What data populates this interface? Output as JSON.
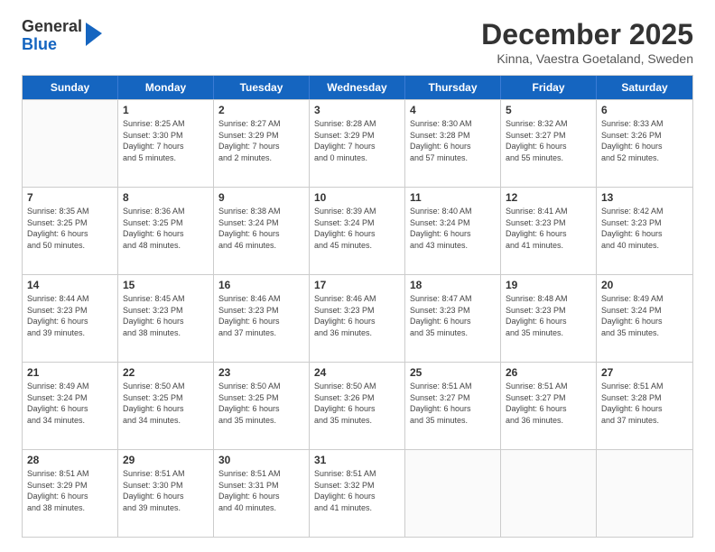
{
  "logo": {
    "general": "General",
    "blue": "Blue"
  },
  "title": "December 2025",
  "subtitle": "Kinna, Vaestra Goetaland, Sweden",
  "header_days": [
    "Sunday",
    "Monday",
    "Tuesday",
    "Wednesday",
    "Thursday",
    "Friday",
    "Saturday"
  ],
  "weeks": [
    [
      {
        "day": "",
        "info": ""
      },
      {
        "day": "1",
        "info": "Sunrise: 8:25 AM\nSunset: 3:30 PM\nDaylight: 7 hours\nand 5 minutes."
      },
      {
        "day": "2",
        "info": "Sunrise: 8:27 AM\nSunset: 3:29 PM\nDaylight: 7 hours\nand 2 minutes."
      },
      {
        "day": "3",
        "info": "Sunrise: 8:28 AM\nSunset: 3:29 PM\nDaylight: 7 hours\nand 0 minutes."
      },
      {
        "day": "4",
        "info": "Sunrise: 8:30 AM\nSunset: 3:28 PM\nDaylight: 6 hours\nand 57 minutes."
      },
      {
        "day": "5",
        "info": "Sunrise: 8:32 AM\nSunset: 3:27 PM\nDaylight: 6 hours\nand 55 minutes."
      },
      {
        "day": "6",
        "info": "Sunrise: 8:33 AM\nSunset: 3:26 PM\nDaylight: 6 hours\nand 52 minutes."
      }
    ],
    [
      {
        "day": "7",
        "info": "Sunrise: 8:35 AM\nSunset: 3:25 PM\nDaylight: 6 hours\nand 50 minutes."
      },
      {
        "day": "8",
        "info": "Sunrise: 8:36 AM\nSunset: 3:25 PM\nDaylight: 6 hours\nand 48 minutes."
      },
      {
        "day": "9",
        "info": "Sunrise: 8:38 AM\nSunset: 3:24 PM\nDaylight: 6 hours\nand 46 minutes."
      },
      {
        "day": "10",
        "info": "Sunrise: 8:39 AM\nSunset: 3:24 PM\nDaylight: 6 hours\nand 45 minutes."
      },
      {
        "day": "11",
        "info": "Sunrise: 8:40 AM\nSunset: 3:24 PM\nDaylight: 6 hours\nand 43 minutes."
      },
      {
        "day": "12",
        "info": "Sunrise: 8:41 AM\nSunset: 3:23 PM\nDaylight: 6 hours\nand 41 minutes."
      },
      {
        "day": "13",
        "info": "Sunrise: 8:42 AM\nSunset: 3:23 PM\nDaylight: 6 hours\nand 40 minutes."
      }
    ],
    [
      {
        "day": "14",
        "info": "Sunrise: 8:44 AM\nSunset: 3:23 PM\nDaylight: 6 hours\nand 39 minutes."
      },
      {
        "day": "15",
        "info": "Sunrise: 8:45 AM\nSunset: 3:23 PM\nDaylight: 6 hours\nand 38 minutes."
      },
      {
        "day": "16",
        "info": "Sunrise: 8:46 AM\nSunset: 3:23 PM\nDaylight: 6 hours\nand 37 minutes."
      },
      {
        "day": "17",
        "info": "Sunrise: 8:46 AM\nSunset: 3:23 PM\nDaylight: 6 hours\nand 36 minutes."
      },
      {
        "day": "18",
        "info": "Sunrise: 8:47 AM\nSunset: 3:23 PM\nDaylight: 6 hours\nand 35 minutes."
      },
      {
        "day": "19",
        "info": "Sunrise: 8:48 AM\nSunset: 3:23 PM\nDaylight: 6 hours\nand 35 minutes."
      },
      {
        "day": "20",
        "info": "Sunrise: 8:49 AM\nSunset: 3:24 PM\nDaylight: 6 hours\nand 35 minutes."
      }
    ],
    [
      {
        "day": "21",
        "info": "Sunrise: 8:49 AM\nSunset: 3:24 PM\nDaylight: 6 hours\nand 34 minutes."
      },
      {
        "day": "22",
        "info": "Sunrise: 8:50 AM\nSunset: 3:25 PM\nDaylight: 6 hours\nand 34 minutes."
      },
      {
        "day": "23",
        "info": "Sunrise: 8:50 AM\nSunset: 3:25 PM\nDaylight: 6 hours\nand 35 minutes."
      },
      {
        "day": "24",
        "info": "Sunrise: 8:50 AM\nSunset: 3:26 PM\nDaylight: 6 hours\nand 35 minutes."
      },
      {
        "day": "25",
        "info": "Sunrise: 8:51 AM\nSunset: 3:27 PM\nDaylight: 6 hours\nand 35 minutes."
      },
      {
        "day": "26",
        "info": "Sunrise: 8:51 AM\nSunset: 3:27 PM\nDaylight: 6 hours\nand 36 minutes."
      },
      {
        "day": "27",
        "info": "Sunrise: 8:51 AM\nSunset: 3:28 PM\nDaylight: 6 hours\nand 37 minutes."
      }
    ],
    [
      {
        "day": "28",
        "info": "Sunrise: 8:51 AM\nSunset: 3:29 PM\nDaylight: 6 hours\nand 38 minutes."
      },
      {
        "day": "29",
        "info": "Sunrise: 8:51 AM\nSunset: 3:30 PM\nDaylight: 6 hours\nand 39 minutes."
      },
      {
        "day": "30",
        "info": "Sunrise: 8:51 AM\nSunset: 3:31 PM\nDaylight: 6 hours\nand 40 minutes."
      },
      {
        "day": "31",
        "info": "Sunrise: 8:51 AM\nSunset: 3:32 PM\nDaylight: 6 hours\nand 41 minutes."
      },
      {
        "day": "",
        "info": ""
      },
      {
        "day": "",
        "info": ""
      },
      {
        "day": "",
        "info": ""
      }
    ]
  ]
}
